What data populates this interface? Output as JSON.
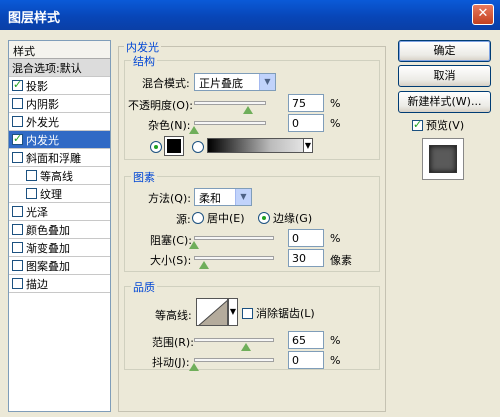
{
  "window": {
    "title": "图层样式",
    "close_glyph": "✕"
  },
  "style_list": {
    "header": "样式",
    "items": [
      {
        "label": "混合选项:默认",
        "checkbox": false,
        "checked": false,
        "indent": false,
        "state": "plain"
      },
      {
        "label": "投影",
        "checkbox": true,
        "checked": true,
        "indent": false,
        "state": "normal"
      },
      {
        "label": "内阴影",
        "checkbox": true,
        "checked": false,
        "indent": false,
        "state": "normal"
      },
      {
        "label": "外发光",
        "checkbox": true,
        "checked": false,
        "indent": false,
        "state": "normal"
      },
      {
        "label": "内发光",
        "checkbox": true,
        "checked": true,
        "indent": false,
        "state": "selected"
      },
      {
        "label": "斜面和浮雕",
        "checkbox": true,
        "checked": false,
        "indent": false,
        "state": "normal"
      },
      {
        "label": "等高线",
        "checkbox": true,
        "checked": false,
        "indent": true,
        "state": "normal"
      },
      {
        "label": "纹理",
        "checkbox": true,
        "checked": false,
        "indent": true,
        "state": "normal"
      },
      {
        "label": "光泽",
        "checkbox": true,
        "checked": false,
        "indent": false,
        "state": "normal"
      },
      {
        "label": "颜色叠加",
        "checkbox": true,
        "checked": false,
        "indent": false,
        "state": "normal"
      },
      {
        "label": "渐变叠加",
        "checkbox": true,
        "checked": false,
        "indent": false,
        "state": "normal"
      },
      {
        "label": "图案叠加",
        "checkbox": true,
        "checked": false,
        "indent": false,
        "state": "normal"
      },
      {
        "label": "描边",
        "checkbox": true,
        "checked": false,
        "indent": false,
        "state": "normal"
      }
    ]
  },
  "inner_glow": {
    "title": "内发光",
    "structure": {
      "title": "结构",
      "blend_mode_label": "混合模式:",
      "blend_mode_value": "正片叠底",
      "opacity_label": "不透明度(O):",
      "opacity_value": "75",
      "opacity_level": 0.75,
      "noise_label": "杂色(N):",
      "noise_value": "0",
      "noise_level": 0,
      "percent": "%",
      "glow_color": "#000000"
    },
    "elements": {
      "title": "图素",
      "method_label": "方法(Q):",
      "method_value": "柔和",
      "source_label": "源:",
      "source_center_label": "居中(E)",
      "source_edge_label": "边缘(G)",
      "choke_label": "阻塞(C):",
      "choke_value": "0",
      "choke_level": 0,
      "size_label": "大小(S):",
      "size_value": "30",
      "size_level": 0.12,
      "percent": "%",
      "px_unit": "像素"
    },
    "quality": {
      "title": "品质",
      "contour_label": "等高线:",
      "antialias_label": "消除锯齿(L)",
      "range_label": "范围(R):",
      "range_value": "65",
      "range_level": 0.65,
      "jitter_label": "抖动(J):",
      "jitter_value": "0",
      "jitter_level": 0,
      "percent": "%"
    }
  },
  "buttons": {
    "ok": "确定",
    "cancel": "取消",
    "new_style": "新建样式(W)...",
    "preview_label": "预览(V)"
  }
}
